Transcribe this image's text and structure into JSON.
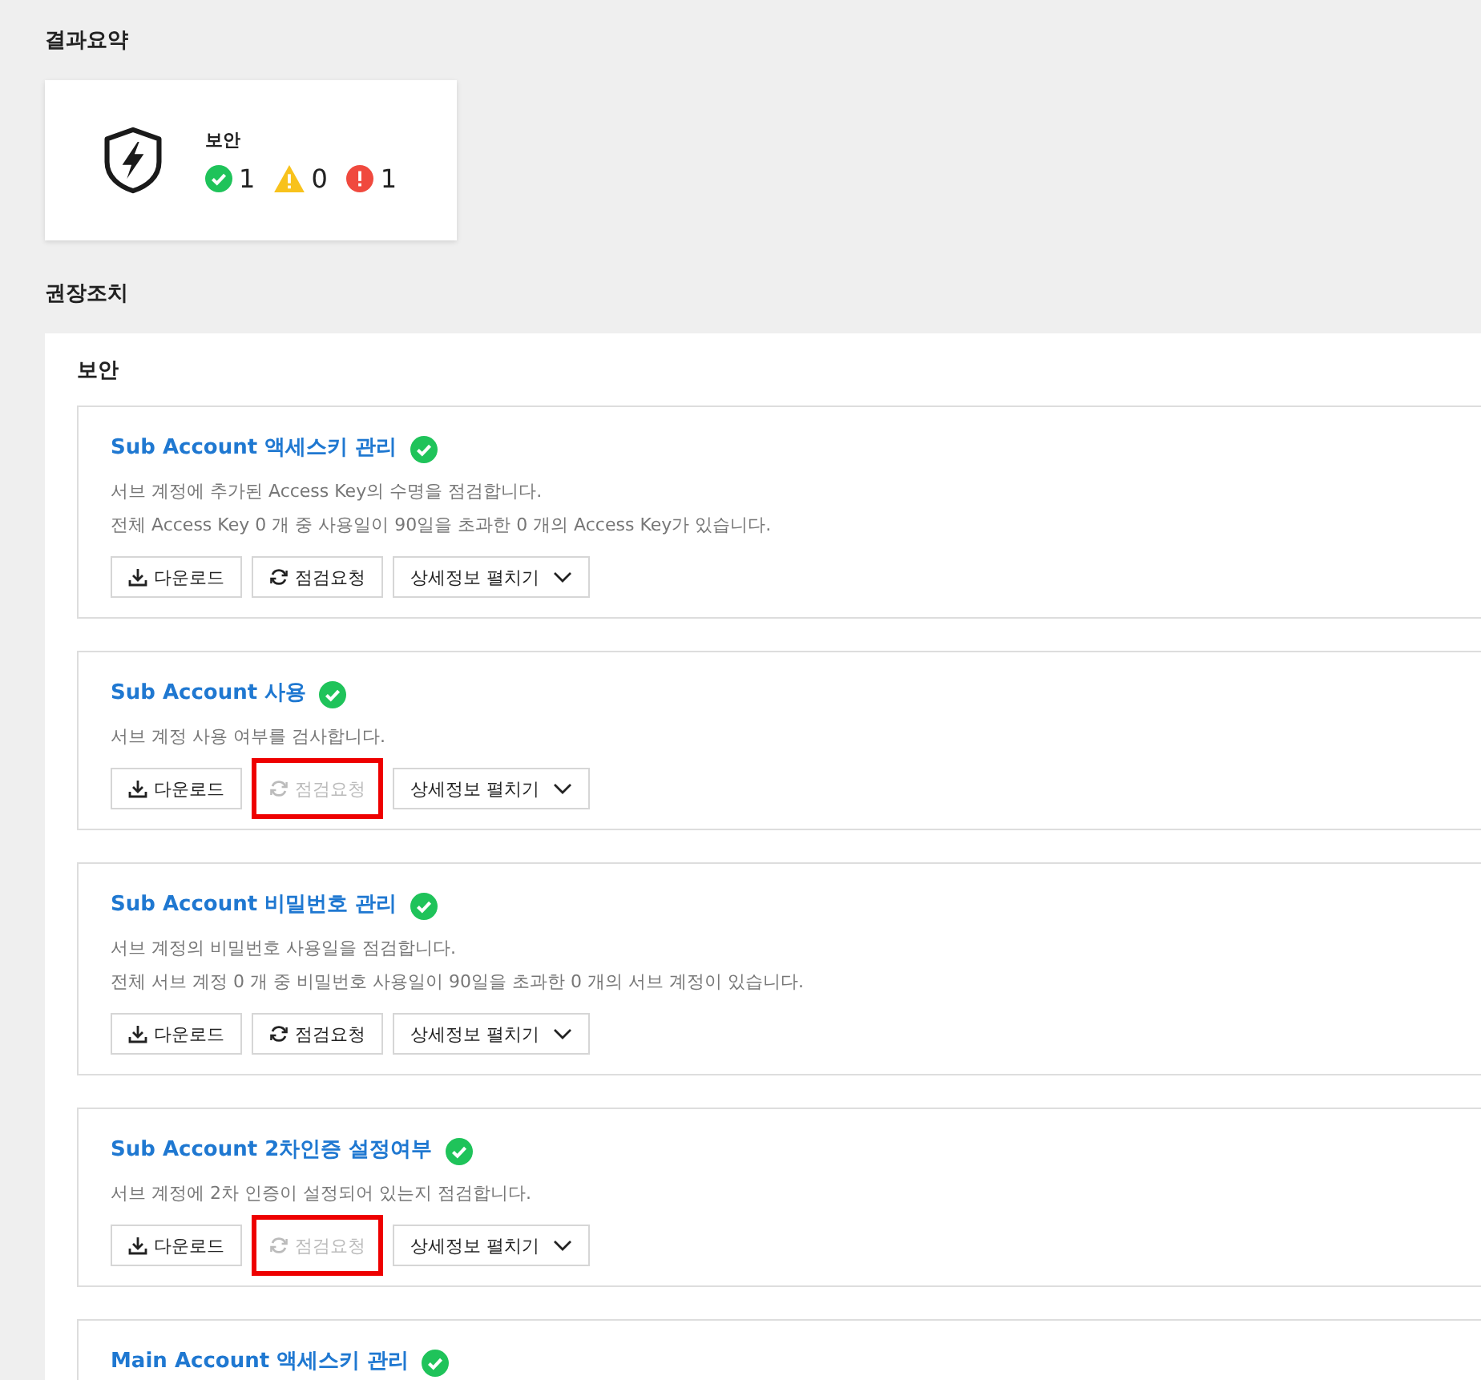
{
  "summary": {
    "title": "결과요약",
    "category": "보안",
    "counts": [
      {
        "kind": "ok",
        "value": "1"
      },
      {
        "kind": "warning",
        "value": "0"
      },
      {
        "kind": "error",
        "value": "1"
      }
    ]
  },
  "recommendations": {
    "title": "권장조치",
    "panel_title": "보안",
    "checks": [
      {
        "title": "Sub Account 액세스키 관리",
        "passed": true,
        "descriptions": [
          "서브 계정에 추가된 Access Key의 수명을 점검합니다.",
          "전체 Access Key 0 개 중 사용일이 90일을 초과한 0 개의 Access Key가 있습니다."
        ],
        "buttons": [
          {
            "kind": "download",
            "label": "다운로드",
            "disabled": false,
            "highlighted": false
          },
          {
            "kind": "refresh",
            "label": "점검요청",
            "disabled": false,
            "highlighted": false
          },
          {
            "kind": "expand",
            "label": "상세정보 펼치기",
            "disabled": false,
            "highlighted": false
          }
        ]
      },
      {
        "title": "Sub Account 사용",
        "passed": true,
        "descriptions": [
          "서브 계정 사용 여부를 검사합니다."
        ],
        "buttons": [
          {
            "kind": "download",
            "label": "다운로드",
            "disabled": false,
            "highlighted": false
          },
          {
            "kind": "refresh",
            "label": "점검요청",
            "disabled": true,
            "highlighted": true
          },
          {
            "kind": "expand",
            "label": "상세정보 펼치기",
            "disabled": false,
            "highlighted": false
          }
        ]
      },
      {
        "title": "Sub Account 비밀번호 관리",
        "passed": true,
        "descriptions": [
          "서브 계정의 비밀번호 사용일을 점검합니다.",
          "전체 서브 계정 0 개 중 비밀번호 사용일이 90일을 초과한 0 개의 서브 계정이 있습니다."
        ],
        "buttons": [
          {
            "kind": "download",
            "label": "다운로드",
            "disabled": false,
            "highlighted": false
          },
          {
            "kind": "refresh",
            "label": "점검요청",
            "disabled": false,
            "highlighted": false
          },
          {
            "kind": "expand",
            "label": "상세정보 펼치기",
            "disabled": false,
            "highlighted": false
          }
        ]
      },
      {
        "title": "Sub Account 2차인증 설정여부",
        "passed": true,
        "descriptions": [
          "서브 계정에 2차 인증이 설정되어 있는지 점검합니다."
        ],
        "buttons": [
          {
            "kind": "download",
            "label": "다운로드",
            "disabled": false,
            "highlighted": false
          },
          {
            "kind": "refresh",
            "label": "점검요청",
            "disabled": true,
            "highlighted": true
          },
          {
            "kind": "expand",
            "label": "상세정보 펼치기",
            "disabled": false,
            "highlighted": false
          }
        ]
      },
      {
        "title": "Main Account 액세스키 관리",
        "passed": true
      }
    ]
  }
}
